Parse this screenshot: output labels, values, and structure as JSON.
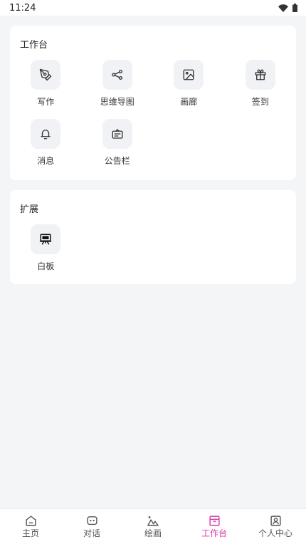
{
  "status": {
    "time": "11:24"
  },
  "workbench": {
    "title": "工作台",
    "items": [
      {
        "label": "写作",
        "icon": "pen-nib-icon"
      },
      {
        "label": "思维导图",
        "icon": "mindmap-icon"
      },
      {
        "label": "画廊",
        "icon": "image-icon"
      },
      {
        "label": "签到",
        "icon": "gift-icon"
      },
      {
        "label": "消息",
        "icon": "bell-icon"
      },
      {
        "label": "公告栏",
        "icon": "notice-board-icon"
      }
    ]
  },
  "extension": {
    "title": "扩展",
    "items": [
      {
        "label": "白板",
        "icon": "whiteboard-icon"
      }
    ]
  },
  "tabbar": {
    "active_color": "#d63ca6",
    "items": [
      {
        "label": "主页",
        "icon": "home-icon"
      },
      {
        "label": "对话",
        "icon": "chat-icon"
      },
      {
        "label": "绘画",
        "icon": "painting-icon"
      },
      {
        "label": "工作台",
        "icon": "archive-box-icon",
        "active": true
      },
      {
        "label": "个人中心",
        "icon": "user-profile-icon"
      }
    ]
  }
}
